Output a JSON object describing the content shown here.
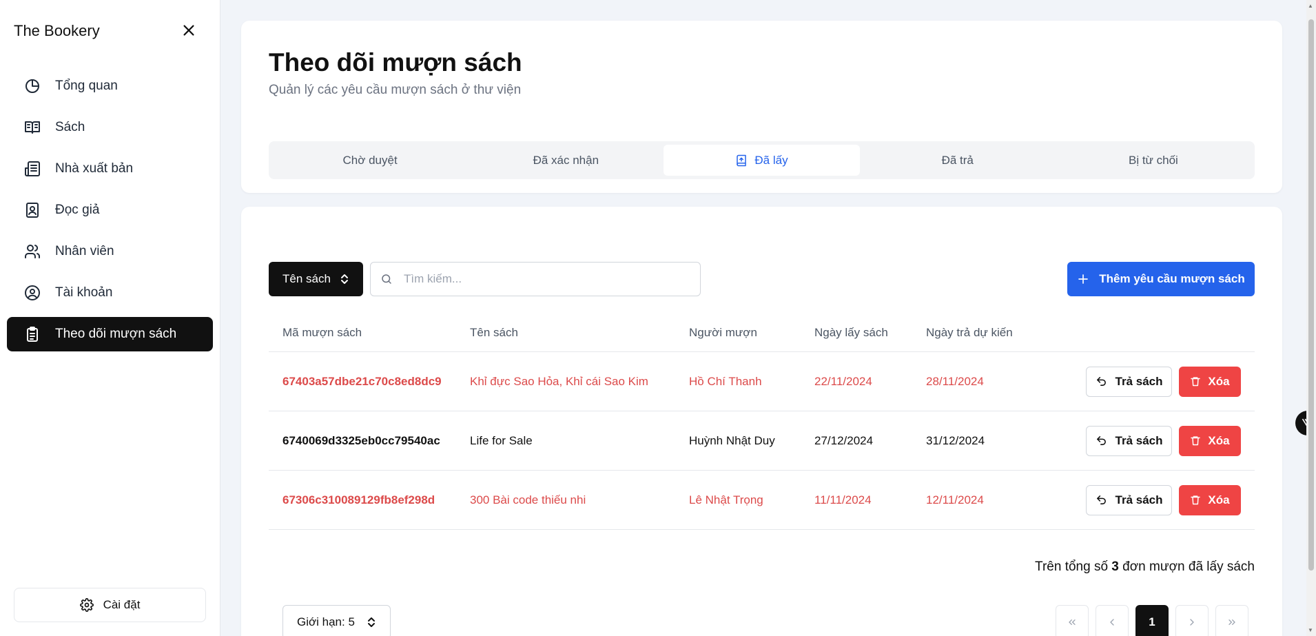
{
  "app": {
    "title": "The Bookery"
  },
  "sidebar": {
    "items": [
      {
        "label": "Tổng quan",
        "icon": "pie-chart-icon"
      },
      {
        "label": "Sách",
        "icon": "book-open-icon"
      },
      {
        "label": "Nhà xuất bản",
        "icon": "newspaper-icon"
      },
      {
        "label": "Đọc giả",
        "icon": "contact-book-icon"
      },
      {
        "label": "Nhân viên",
        "icon": "users-icon"
      },
      {
        "label": "Tài khoản",
        "icon": "user-circle-icon"
      },
      {
        "label": "Theo dõi mượn sách",
        "icon": "clipboard-list-icon"
      }
    ],
    "active_index": 6,
    "settings_label": "Cài đặt"
  },
  "header": {
    "title": "Theo dõi mượn sách",
    "subtitle": "Quản lý các yêu cầu mượn sách ở thư viện",
    "tabs": [
      {
        "label": "Chờ duyệt"
      },
      {
        "label": "Đã xác nhận"
      },
      {
        "label": "Đã lấy"
      },
      {
        "label": "Đã trả"
      },
      {
        "label": "Bị từ chối"
      }
    ],
    "active_tab": 2
  },
  "toolbar": {
    "filter_label": "Tên sách",
    "search_placeholder": "Tìm kiếm...",
    "add_label": "Thêm yêu cầu mượn sách"
  },
  "table": {
    "columns": [
      "Mã mượn sách",
      "Tên sách",
      "Người mượn",
      "Ngày lấy sách",
      "Ngày trả dự kiến"
    ],
    "rows": [
      {
        "id": "67403a57dbe21c70c8ed8dc9",
        "book": "Khỉ đực Sao Hỏa, Khỉ cái Sao Kim",
        "borrower": "Hồ Chí Thanh",
        "pickup": "22/11/2024",
        "due": "28/11/2024",
        "overdue": true
      },
      {
        "id": "6740069d3325eb0cc79540ac",
        "book": "Life for Sale",
        "borrower": "Huỳnh Nhật Duy",
        "pickup": "27/12/2024",
        "due": "31/12/2024",
        "overdue": false
      },
      {
        "id": "67306c310089129fb8ef298d",
        "book": "300 Bài code thiếu nhi",
        "borrower": "Lê Nhật Trọng",
        "pickup": "11/11/2024",
        "due": "12/11/2024",
        "overdue": true
      }
    ],
    "return_label": "Trả sách",
    "delete_label": "Xóa"
  },
  "summary": {
    "prefix": "Trên tổng số",
    "count": "3",
    "suffix": "đơn mượn đã lấy sách"
  },
  "pagination": {
    "limit_label": "Giới hạn: 5",
    "current_page": "1"
  },
  "colors": {
    "accent": "#2563eb",
    "danger": "#ef4444",
    "overdue_text": "#dc4a4a",
    "dark": "#111111"
  }
}
